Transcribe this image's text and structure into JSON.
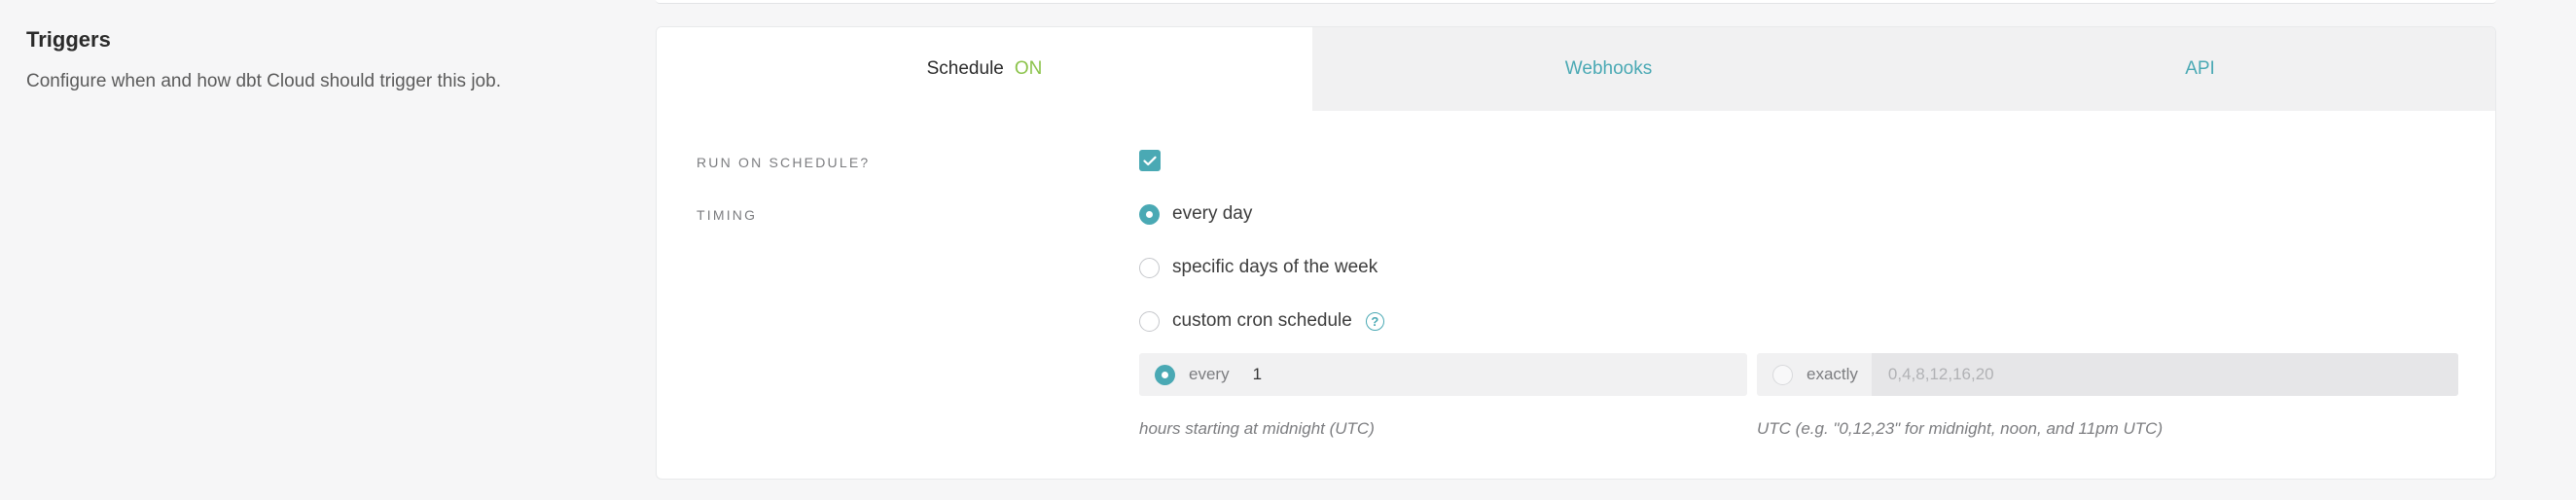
{
  "section": {
    "title": "Triggers",
    "description": "Configure when and how dbt Cloud should trigger this job."
  },
  "tabs": [
    {
      "label": "Schedule",
      "status": "ON",
      "active": true
    },
    {
      "label": "Webhooks",
      "active": false
    },
    {
      "label": "API",
      "active": false
    }
  ],
  "schedule": {
    "run_on_schedule_label": "RUN ON SCHEDULE?",
    "run_on_schedule_checked": true,
    "timing_label": "TIMING",
    "timing_options": [
      {
        "label": "every day",
        "selected": true
      },
      {
        "label": "specific days of the week",
        "selected": false
      },
      {
        "label": "custom cron schedule",
        "selected": false
      }
    ],
    "help_glyph": "?",
    "every": {
      "label": "every",
      "value": "1",
      "selected": true,
      "hint": "hours starting at midnight (UTC)"
    },
    "exactly": {
      "label": "exactly",
      "placeholder": "0,4,8,12,16,20",
      "selected": false,
      "hint": "UTC (e.g. \"0,12,23\" for midnight, noon, and 11pm UTC)"
    }
  },
  "colors": {
    "accent": "#4aa9b4",
    "on_status": "#8bc34a"
  }
}
